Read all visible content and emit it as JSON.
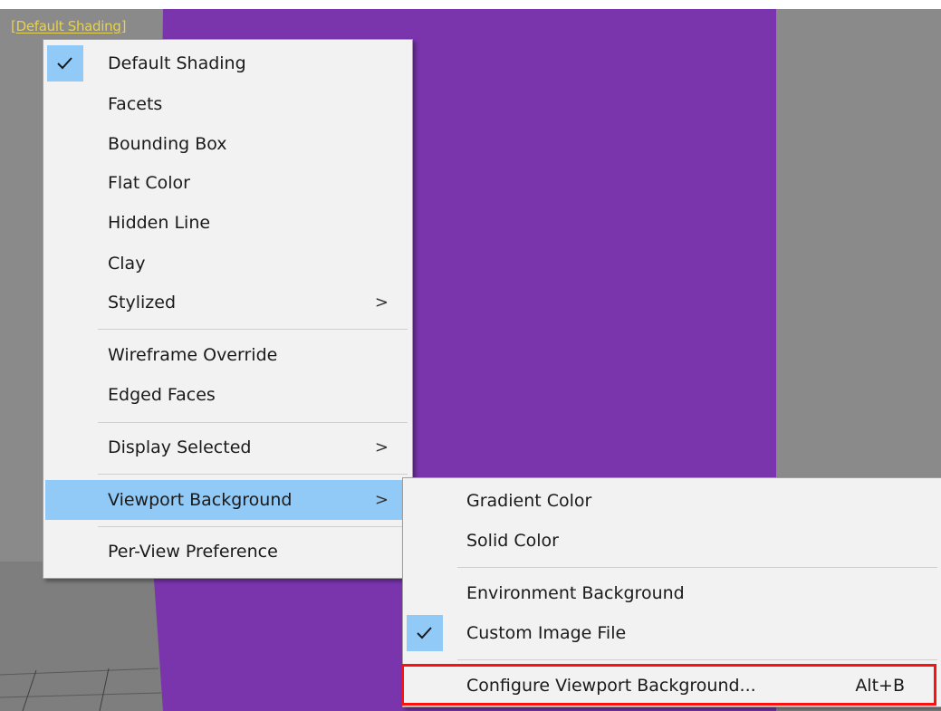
{
  "viewport": {
    "label_open": "[",
    "label": "Default Shading",
    "label_close": "]",
    "object_color": "#7a35ad"
  },
  "main_menu": {
    "items": [
      {
        "label": "Default Shading",
        "checked": true
      },
      {
        "label": "Facets"
      },
      {
        "label": "Bounding Box"
      },
      {
        "label": "Flat Color"
      },
      {
        "label": "Hidden Line"
      },
      {
        "label": "Clay"
      },
      {
        "label": "Stylized",
        "submenu_arrow": ">"
      },
      {
        "label": "Wireframe Override"
      },
      {
        "label": "Edged Faces"
      },
      {
        "label": "Display Selected",
        "submenu_arrow": ">"
      },
      {
        "label": "Viewport Background",
        "submenu_arrow": ">",
        "highlighted": true
      },
      {
        "label": "Per-View Preference"
      }
    ]
  },
  "sub_menu": {
    "items": [
      {
        "label": "Gradient Color"
      },
      {
        "label": "Solid Color"
      },
      {
        "label": "Environment Background"
      },
      {
        "label": "Custom Image File",
        "checked": true
      },
      {
        "label": "Configure Viewport Background...",
        "shortcut": "Alt+B",
        "emphasized": true
      }
    ]
  },
  "colors": {
    "highlight": "#91c9f7",
    "emphasis_border": "#ff1010",
    "label_yellow": "#e8d24a"
  }
}
